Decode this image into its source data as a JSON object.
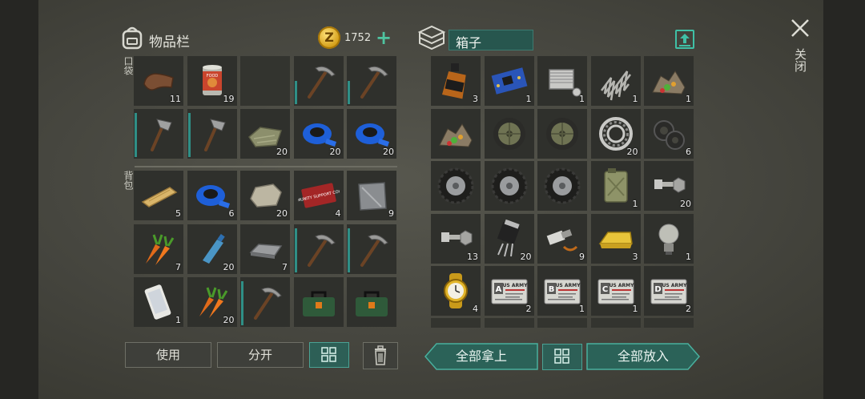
{
  "inventory": {
    "title": "物品栏",
    "coins": "1752",
    "coin_symbol": "Z",
    "pocket_label": "口袋",
    "backpack_label": "背包",
    "pocket_slots": [
      {
        "icon": "leather-icon",
        "qty": "11"
      },
      {
        "icon": "canned-food-icon",
        "qty": "19"
      },
      {
        "icon": "",
        "qty": ""
      },
      {
        "icon": "pickaxe-icon",
        "qty": "",
        "durability": 0.5
      },
      {
        "icon": "pickaxe-icon",
        "qty": "",
        "durability": 0.5
      },
      {
        "icon": "hatchet-icon",
        "qty": "",
        "durability": 0.95
      },
      {
        "icon": "hatchet-icon",
        "qty": "",
        "durability": 0.95
      },
      {
        "icon": "cloth-icon",
        "qty": "20"
      },
      {
        "icon": "duct-tape-icon",
        "qty": "20"
      },
      {
        "icon": "duct-tape-icon",
        "qty": "20"
      }
    ],
    "backpack_slots": [
      {
        "icon": "wood-plank-icon",
        "qty": "5"
      },
      {
        "icon": "duct-tape-icon",
        "qty": "6"
      },
      {
        "icon": "stone-icon",
        "qty": "20"
      },
      {
        "icon": "coupon-icon",
        "qty": "4"
      },
      {
        "icon": "metal-plate-icon",
        "qty": "9"
      },
      {
        "icon": "carrot-icon",
        "qty": "7"
      },
      {
        "icon": "water-bottle-icon",
        "qty": "20"
      },
      {
        "icon": "iron-bar-icon",
        "qty": "7"
      },
      {
        "icon": "pickaxe-icon",
        "qty": "",
        "durability": 0.95
      },
      {
        "icon": "pickaxe-icon",
        "qty": "",
        "durability": 0.95
      },
      {
        "icon": "smartphone-icon",
        "qty": "1"
      },
      {
        "icon": "carrot-icon",
        "qty": "20"
      },
      {
        "icon": "pickaxe-icon",
        "qty": "",
        "durability": 0.95
      },
      {
        "icon": "toolbox-icon",
        "qty": ""
      },
      {
        "icon": "toolbox-icon",
        "qty": ""
      }
    ],
    "coupon_text": "COMMUNITY SUPPORT COUPON",
    "can_text": "FOOD",
    "use_label": "使用",
    "split_label": "分开"
  },
  "box": {
    "title": "箱子",
    "slots": [
      {
        "icon": "whiskey-bottle-icon",
        "qty": "3"
      },
      {
        "icon": "circuit-board-icon",
        "qty": "1"
      },
      {
        "icon": "engine-cylinder-icon",
        "qty": "1"
      },
      {
        "icon": "spring-icon",
        "qty": "1"
      },
      {
        "icon": "ore-pile-icon",
        "qty": "1"
      },
      {
        "icon": "ore-pile-icon",
        "qty": ""
      },
      {
        "icon": "car-wheel-icon",
        "qty": ""
      },
      {
        "icon": "car-wheel-icon",
        "qty": ""
      },
      {
        "icon": "bearing-icon",
        "qty": "20"
      },
      {
        "icon": "washer-icon",
        "qty": "6"
      },
      {
        "icon": "tire-icon",
        "qty": ""
      },
      {
        "icon": "tire-icon",
        "qty": ""
      },
      {
        "icon": "tire-icon",
        "qty": ""
      },
      {
        "icon": "jerry-can-icon",
        "qty": "1"
      },
      {
        "icon": "bolt-nut-icon",
        "qty": "20"
      },
      {
        "icon": "bolt-nut-icon",
        "qty": "13"
      },
      {
        "icon": "transistor-icon",
        "qty": "20"
      },
      {
        "icon": "spark-plug-icon",
        "qty": "9"
      },
      {
        "icon": "gold-bar-icon",
        "qty": "3"
      },
      {
        "icon": "light-bulb-icon",
        "qty": "1"
      },
      {
        "icon": "gold-watch-icon",
        "qty": "4"
      },
      {
        "icon": "army-card-a-icon",
        "qty": "2",
        "letter": "A"
      },
      {
        "icon": "army-card-b-icon",
        "qty": "1",
        "letter": "B"
      },
      {
        "icon": "army-card-c-icon",
        "qty": "1",
        "letter": "C"
      },
      {
        "icon": "army-card-d-icon",
        "qty": "2",
        "letter": "D"
      }
    ],
    "army_text": "US ARMY",
    "take_all_label": "全部拿上",
    "put_all_label": "全部放入"
  },
  "close_label": "关闭",
  "colors": {
    "accent": "#3fc0a6",
    "accent_dark": "#27564e",
    "slot_bg": "#2f302c",
    "durability": "#2f8f86"
  }
}
